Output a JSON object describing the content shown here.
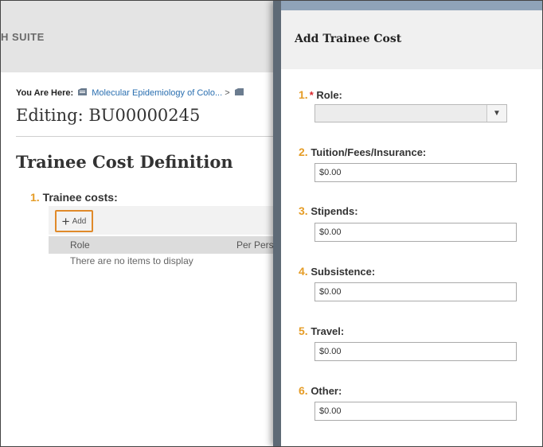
{
  "app": {
    "brand": "H SUITE"
  },
  "breadcrumb": {
    "label": "You Are Here:",
    "item": "Molecular Epidemiology of Colo...",
    "separator": ">"
  },
  "page": {
    "editing_title": "Editing: BU00000245",
    "section_title": "Trainee Cost Definition"
  },
  "trainee_costs": {
    "number": "1.",
    "label": "Trainee costs:",
    "add_label": "Add",
    "columns": [
      "Role",
      "Per Pers"
    ],
    "empty_message": "There are no items to display"
  },
  "modal": {
    "title": "Add Trainee Cost",
    "fields": [
      {
        "number": "1.",
        "label": "Role:",
        "required": "*",
        "value": ""
      },
      {
        "number": "2.",
        "label": "Tuition/Fees/Insurance:",
        "value": "$0.00"
      },
      {
        "number": "3.",
        "label": "Stipends:",
        "value": "$0.00"
      },
      {
        "number": "4.",
        "label": "Subsistence:",
        "value": "$0.00"
      },
      {
        "number": "5.",
        "label": "Travel:",
        "value": "$0.00"
      },
      {
        "number": "6.",
        "label": "Other:",
        "value": "$0.00"
      }
    ]
  },
  "icons": {
    "dropdown": "chevron-down-icon",
    "add": "plus-icon",
    "breadcrumb_doc": "document-icon"
  },
  "colors": {
    "accent_number": "#e59c26",
    "required": "#d9262c",
    "add_highlight": "#e08a2a",
    "link": "#2a6fb0"
  }
}
